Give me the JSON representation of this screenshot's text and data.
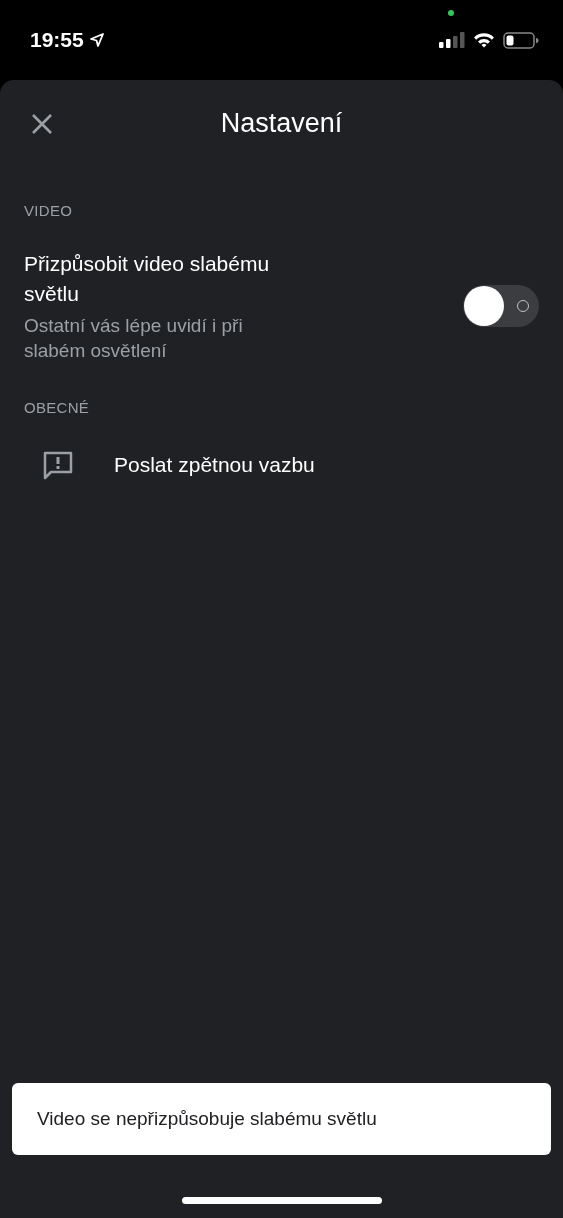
{
  "status_bar": {
    "time": "19:55"
  },
  "header": {
    "title": "Nastavení"
  },
  "sections": [
    {
      "heading": "VIDEO",
      "items": [
        {
          "kind": "toggle",
          "title": "Přizpůsobit video slabému světlu",
          "subtitle": "Ostatní vás lépe uvidí i při slabém osvětlení",
          "on": false
        }
      ]
    },
    {
      "heading": "OBECNÉ",
      "items": [
        {
          "kind": "link",
          "title": "Poslat zpětnou vazbu"
        }
      ]
    }
  ],
  "snackbar": {
    "message": "Video se nepřizpůsobuje slabému světlu"
  }
}
